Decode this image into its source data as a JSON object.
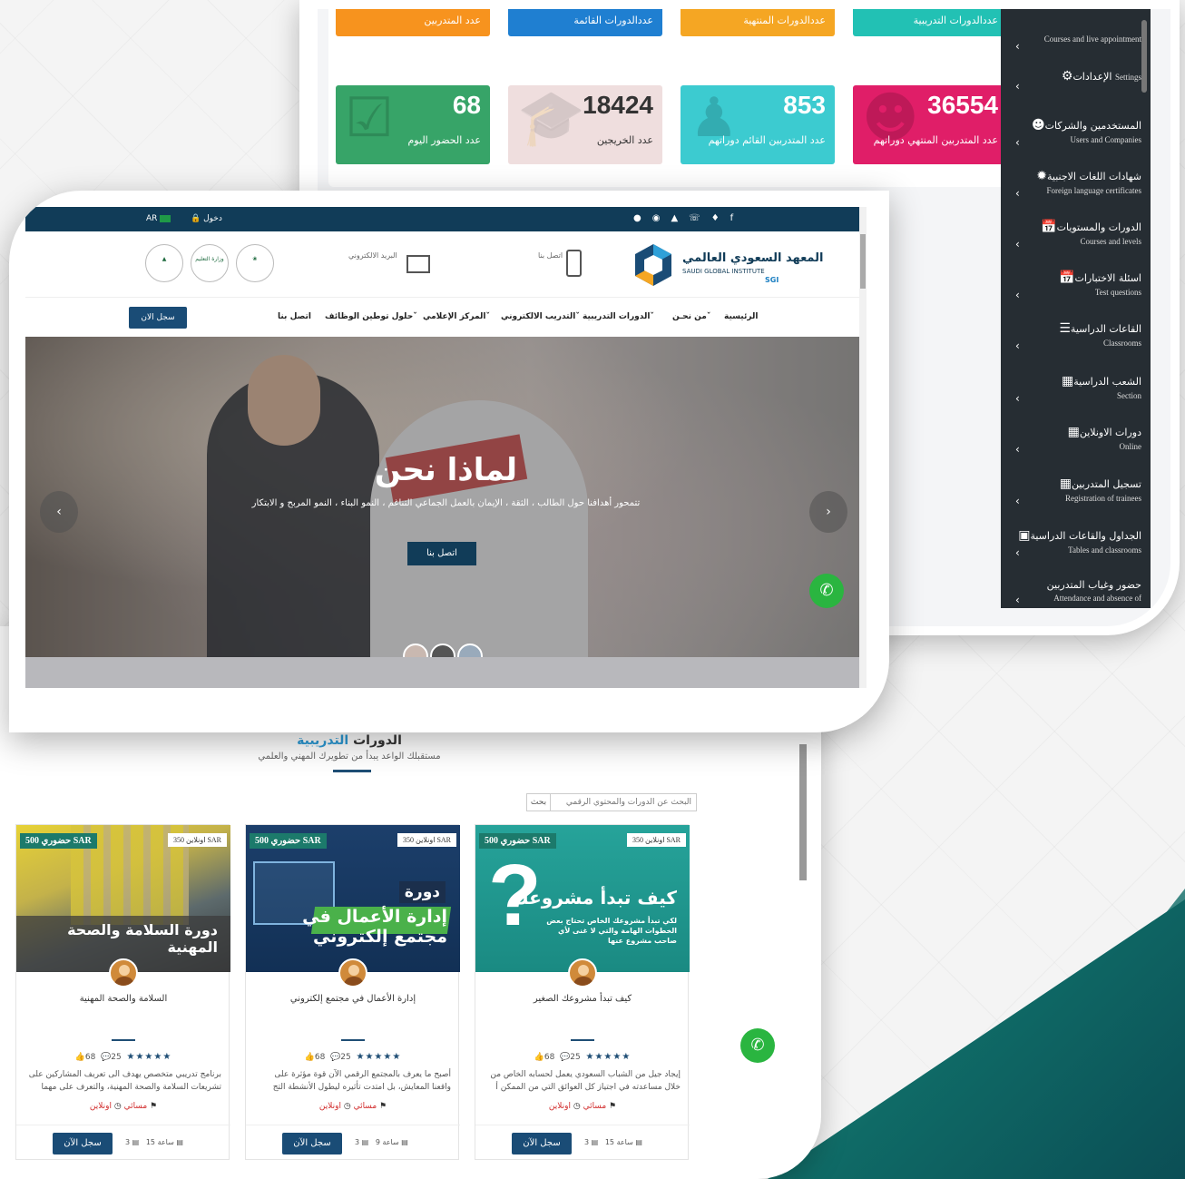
{
  "dashboard": {
    "stats_top": [
      {
        "label": "عدد المتدربين",
        "color": "#f7931e"
      },
      {
        "label": "عددالدورات القائمة",
        "color": "#1f7fd1"
      },
      {
        "label": "عددالدورات المنتهية",
        "color": "#f5a623"
      },
      {
        "label": "عددالدورات التدريبية",
        "color": "#22c1b4"
      }
    ],
    "stats_bottom": [
      {
        "value": "68",
        "label": "عدد الحضور اليوم",
        "color": "#37a468"
      },
      {
        "value": "18424",
        "label": "عدد الخريجين",
        "color": "#efdede"
      },
      {
        "value": "853",
        "label": "عدد المتدربين القائم دوراتهم",
        "color": "#3ccbd0"
      },
      {
        "value": "36554",
        "label": "عدد المتدربين المنتهي دوراتهم",
        "color": "#e01e68"
      }
    ],
    "sidebar": [
      {
        "ar": "",
        "en": "Courses and live appointment"
      },
      {
        "ar": "الإعدادات",
        "en": "Settings"
      },
      {
        "ar": "المستخدمين والشركات",
        "en": "Users and Companies"
      },
      {
        "ar": "شهادات اللغات الاجنبية",
        "en": "Foreign language certificates"
      },
      {
        "ar": "الدورات والمستويات",
        "en": "Courses and levels"
      },
      {
        "ar": "اسئلة الاختبارات",
        "en": "Test questions"
      },
      {
        "ar": "القاعات الدراسية",
        "en": "Classrooms"
      },
      {
        "ar": "الشعب الدراسية",
        "en": "Section"
      },
      {
        "ar": "دورات الاونلاين",
        "en": "Online"
      },
      {
        "ar": "تسجيل المتدربين",
        "en": "Registration of trainees"
      },
      {
        "ar": "الجداول والقاعات الدراسية",
        "en": "Tables and classrooms"
      },
      {
        "ar": "حضور وغياب المتدربين",
        "en": "Attendance and absence of"
      }
    ]
  },
  "website": {
    "topbar": {
      "login": "دخول",
      "lang": "AR"
    },
    "logo": {
      "ar": "المعهد السعودي العالمي",
      "en": "SAUDI GLOBAL INSTITUTE",
      "abbr": "SGI"
    },
    "header": {
      "contact": "اتصل بنا",
      "email": "البريد الالكتروني",
      "gov_logo_1": "وزارة التعليم"
    },
    "nav": {
      "home": "الرئيسية",
      "about": "من نحـن",
      "courses": "الدورات التدريبية",
      "elearning": "التدريب الالكتروني",
      "media": "المركز الإعلامي",
      "jobs": "حلول توطين الوظائف",
      "contact": "اتصل بنا",
      "register": "سجل الان"
    },
    "hero": {
      "title": "لماذا نحن",
      "subtitle": "تتمحور أهدافنا حول الطالب ، الثقة ، الإيمان بالعمل الجماعي التناغم ، النمو البناء ، النمو المربح و الابتكار",
      "button": "اتصل بنا"
    }
  },
  "courses_page": {
    "section_title_1": "الدورات",
    "section_title_2": "التدريبية",
    "section_subtitle": "مستقبلك الواعد يبدأ من تطويرك المهني والعلمي",
    "search_placeholder": "البحث عن الدورات والمحتوي الرقمي",
    "search_button": "بحث",
    "cards": [
      {
        "badge_offline": "حضوري 500 SAR",
        "badge_online": "اونلاين 350 SAR",
        "image_title": "دورة السلامة والصحة المهنية",
        "name": "السلامة والصحة المهنية",
        "rating_stars": "★★★★★",
        "comments": "25",
        "likes": "68",
        "desc": "برنامج تدريبي متخصص يهدف الى تعريف المشاركين على تشريعات السلامة والصحة المهنية، والتعرف على مهما",
        "mode": "اونلاين",
        "time": "مسائي",
        "lessons": "3",
        "hours": "15 ساعة",
        "button": "سجل الآن"
      },
      {
        "badge_offline": "حضوري 500 SAR",
        "badge_online": "اونلاين 350 SAR",
        "image_title": "دورة إدارة الأعمال في مجتمع إلكتروني",
        "name": "إدارة الأعمال في مجتمع إلكتروني",
        "rating_stars": "★★★★★",
        "comments": "25",
        "likes": "68",
        "desc": "أصبح ما يعرف بالمجتمع الرقمي الآن قوة مؤثرة على واقعنا المعايش، بل امتدت تأثيره ليطول الأنشطة التج",
        "mode": "اونلاين",
        "time": "مسائي",
        "lessons": "3",
        "hours": "9 ساعة",
        "button": "سجل الآن"
      },
      {
        "badge_offline": "حضوري 500 SAR",
        "badge_online": "اونلاين 350 SAR",
        "image_title": "كيف تبدأ مشروعك",
        "image_sub": "لكي تبدأ مشروعك الخاص تحتاج بعض الخطوات الهامة والتي لا غنى لأي صاحب مشروع عنها",
        "name": "كيف تبدأ مشروعك الصغير",
        "rating_stars": "★★★★★",
        "comments": "25",
        "likes": "68",
        "desc": "إيجاد جيل من الشباب السعودي يعمل لحسابه الخاص من خلال مساعدته في اجتياز كل العوائق التي من الممكن أ",
        "mode": "اونلاين",
        "time": "مسائي",
        "lessons": "3",
        "hours": "15 ساعة",
        "button": "سجل الآن"
      }
    ]
  }
}
